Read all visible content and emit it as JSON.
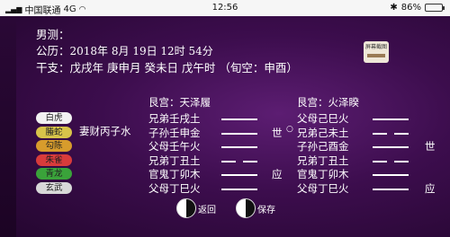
{
  "status_bar": {
    "carrier": "中国联通",
    "network": "4G",
    "time": "12:56",
    "battery": "86%",
    "battery_level": 0.86
  },
  "info": {
    "gender": "男测：",
    "gregorian_label": "公历：",
    "gregorian_value": "2018年 8月 19日 12时 54分",
    "ganzhi_label": "干支：",
    "ganzhi_value": "戊戌年 庚申月 癸未日 戊午时 （旬空：申酉）"
  },
  "badge": {
    "label": "屏幕截图"
  },
  "hexagrams": {
    "main_title": "艮宫：天泽履",
    "changed_title": "艮宫：火泽睽"
  },
  "spirits": [
    {
      "name": "白虎",
      "color": "#f2f2f2"
    },
    {
      "name": "螣蛇",
      "color": "#d8c44a"
    },
    {
      "name": "勾陈",
      "color": "#d79c2c"
    },
    {
      "name": "朱雀",
      "color": "#d93b3b"
    },
    {
      "name": "青龙",
      "color": "#3aa33a"
    },
    {
      "name": "玄武",
      "color": "#d8d8d8"
    }
  ],
  "fushen": "妻财丙子水",
  "main_lines": [
    "兄弟壬戌土",
    "子孙壬申金",
    "父母壬午火",
    "兄弟丁丑土",
    "官鬼丁卯木",
    "父母丁巳火"
  ],
  "main_yao": [
    "yang",
    "yang",
    "yang",
    "yin",
    "yang",
    "yang"
  ],
  "main_marks": [
    "",
    "世",
    "",
    "",
    "应",
    ""
  ],
  "move_marks": [
    "",
    "○",
    "",
    "",
    "",
    ""
  ],
  "changed_lines": [
    "父母己巳火",
    "兄弟己未土",
    "子孙己酉金",
    "兄弟丁丑土",
    "官鬼丁卯木",
    "父母丁巳火"
  ],
  "changed_yao": [
    "yang",
    "yin",
    "yang",
    "yin",
    "yang",
    "yang"
  ],
  "changed_marks": [
    "",
    "",
    "世",
    "",
    "",
    "应"
  ],
  "buttons": {
    "left": "返回",
    "right": "保存"
  }
}
